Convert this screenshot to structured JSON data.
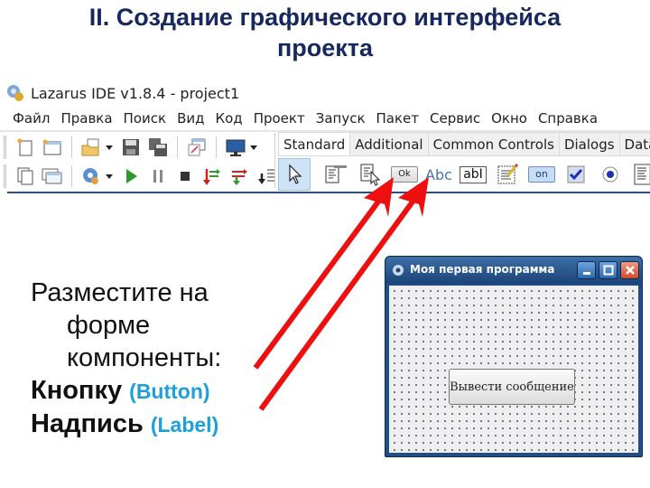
{
  "slide": {
    "title_line1": "II. Создание графического интерфейса",
    "title_line2": "проекта"
  },
  "ide": {
    "window_title": "Lazarus IDE v1.8.4 - project1",
    "menu": [
      "Файл",
      "Правка",
      "Поиск",
      "Вид",
      "Код",
      "Проект",
      "Запуск",
      "Пакет",
      "Сервис",
      "Окно",
      "Справка"
    ],
    "toolbar_row1": [
      "new-unit-icon",
      "new-form-icon",
      "open-icon",
      "save-icon",
      "save-all-icon",
      "toggle-form-unit-icon",
      "view-forms-icon"
    ],
    "toolbar_row2": [
      "view-units-icon",
      "view-forms-list-icon",
      "build-mode-icon",
      "run-icon",
      "pause-icon",
      "stop-icon",
      "step-into-icon",
      "step-over-icon",
      "step-out-icon"
    ],
    "palette_tabs": [
      "Standard",
      "Additional",
      "Common Controls",
      "Dialogs",
      "Data Con"
    ],
    "active_tab": "Standard",
    "palette_components": [
      {
        "name": "selection-pointer",
        "label": ""
      },
      {
        "name": "TMainMenu",
        "label": ""
      },
      {
        "name": "TPopupMenu",
        "label": ""
      },
      {
        "name": "TButton",
        "label": "Ok"
      },
      {
        "name": "TLabel",
        "label": "Abc"
      },
      {
        "name": "TEdit",
        "label": "ab"
      },
      {
        "name": "TMemo",
        "label": ""
      },
      {
        "name": "TToggleBox",
        "label": "on"
      },
      {
        "name": "TCheckBox",
        "label": ""
      },
      {
        "name": "TRadioButton",
        "label": ""
      },
      {
        "name": "TListBox",
        "label": ""
      },
      {
        "name": "TComboBox",
        "label": ""
      }
    ]
  },
  "instructions": {
    "line1": "Разместите на",
    "line2": "форме",
    "line3": "компоненты:",
    "button_word": "Кнопку",
    "button_hint": "(Button)",
    "label_word": "Надпись",
    "label_hint": "(Label)"
  },
  "form_window": {
    "caption": "Моя первая программа",
    "button_caption": "Вывести сообщение"
  },
  "colors": {
    "title": "#17285e",
    "hint": "#1d9fd8",
    "arrow": "#ee0f0f"
  }
}
